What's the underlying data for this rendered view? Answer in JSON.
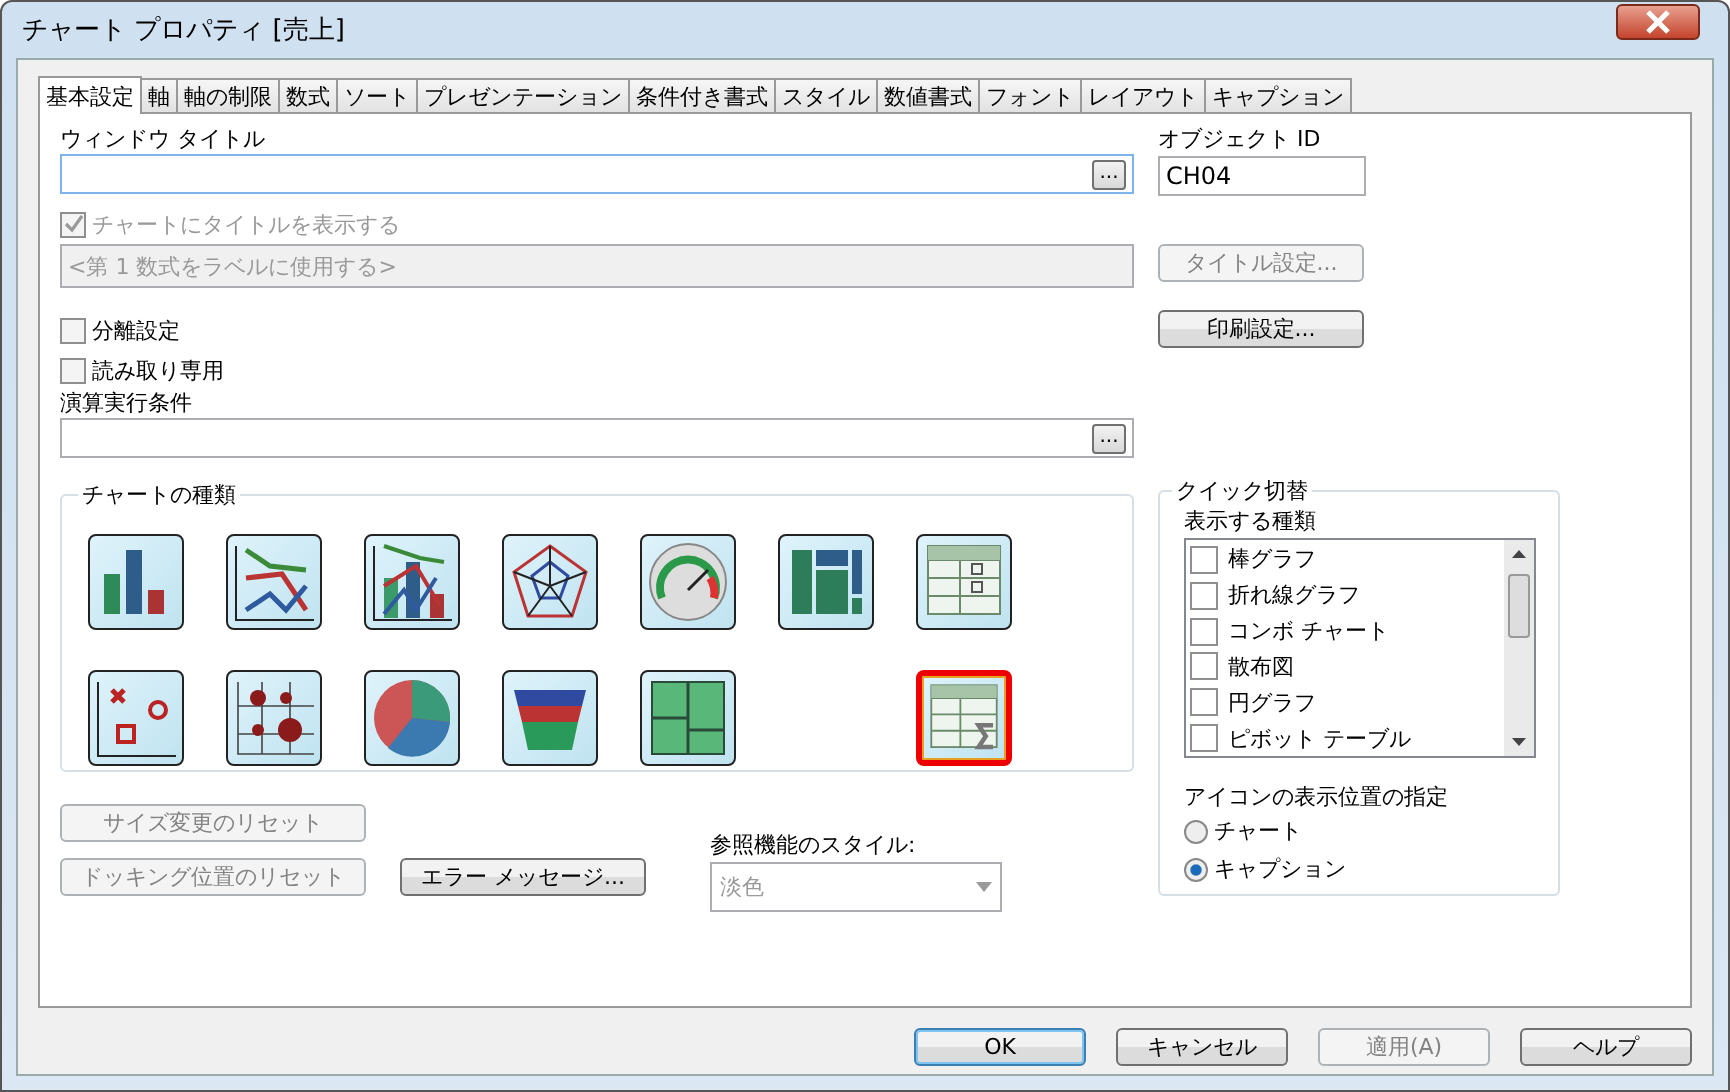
{
  "window": {
    "title": "チャート プロパティ [売上]"
  },
  "tabs": [
    {
      "label": "基本設定",
      "selected": true
    },
    {
      "label": "軸",
      "selected": false
    },
    {
      "label": "軸の制限",
      "selected": false
    },
    {
      "label": "数式",
      "selected": false
    },
    {
      "label": "ソート",
      "selected": false
    },
    {
      "label": "プレゼンテーション",
      "selected": false
    },
    {
      "label": "条件付き書式",
      "selected": false
    },
    {
      "label": "スタイル",
      "selected": false
    },
    {
      "label": "数値書式",
      "selected": false
    },
    {
      "label": "フォント",
      "selected": false
    },
    {
      "label": "レイアウト",
      "selected": false
    },
    {
      "label": "キャプション",
      "selected": false
    }
  ],
  "window_title": {
    "label": "ウィンドウ タイトル",
    "browse_button": "..."
  },
  "object_id": {
    "label": "オブジェクト ID",
    "value": "CH04"
  },
  "show_title": {
    "label": "チャートにタイトルを表示する",
    "checked": true,
    "disabled": true
  },
  "title_field": {
    "value": "<第 1 数式をラベルに使用する>",
    "disabled": true
  },
  "title_settings_button": {
    "label": "タイトル設定...",
    "disabled": true
  },
  "print_settings_button": {
    "label": "印刷設定...",
    "disabled": false
  },
  "options": [
    {
      "label": "分離設定",
      "checked": false
    },
    {
      "label": "読み取り専用",
      "checked": false
    }
  ],
  "calc_condition": {
    "label": "演算実行条件",
    "browse_button": "..."
  },
  "chart_types": {
    "label": "チャートの種類",
    "items": [
      {
        "kind": "bar",
        "selected": false
      },
      {
        "kind": "line",
        "selected": false
      },
      {
        "kind": "combo",
        "selected": false
      },
      {
        "kind": "radar",
        "selected": false
      },
      {
        "kind": "gauge",
        "selected": false
      },
      {
        "kind": "mekko",
        "selected": false
      },
      {
        "kind": "pivot",
        "selected": false
      },
      {
        "kind": "scatter",
        "selected": false
      },
      {
        "kind": "grid",
        "selected": false
      },
      {
        "kind": "pie",
        "selected": false
      },
      {
        "kind": "funnel",
        "selected": false
      },
      {
        "kind": "block",
        "selected": false
      },
      {
        "kind": "straight",
        "selected": true
      }
    ]
  },
  "quick_change": {
    "label": "クイック切替",
    "list_label": "表示する種類",
    "items": [
      {
        "label": "棒グラフ",
        "checked": false
      },
      {
        "label": "折れ線グラフ",
        "checked": false
      },
      {
        "label": "コンボ チャート",
        "checked": false
      },
      {
        "label": "散布図",
        "checked": false
      },
      {
        "label": "円グラフ",
        "checked": false
      },
      {
        "label": "ピボット テーブル",
        "checked": false
      }
    ],
    "position_label": "アイコンの表示位置の指定",
    "positions": [
      {
        "label": "チャート",
        "selected": false
      },
      {
        "label": "キャプション",
        "selected": true
      }
    ]
  },
  "reset_buttons": [
    {
      "label": "サイズ変更のリセット",
      "disabled": true
    },
    {
      "label": "ドッキング位置のリセット",
      "disabled": true
    }
  ],
  "error_button": {
    "label": "エラー メッセージ...",
    "disabled": false
  },
  "lookup_style": {
    "label": "参照機能のスタイル:",
    "value": "淡色",
    "disabled": true
  },
  "buttons": [
    {
      "label": "OK",
      "default": true,
      "disabled": false
    },
    {
      "label": "キャンセル",
      "default": false,
      "disabled": false
    },
    {
      "label": "適用(A)",
      "default": false,
      "disabled": true
    },
    {
      "label": "ヘルプ",
      "default": false,
      "disabled": false
    }
  ]
}
